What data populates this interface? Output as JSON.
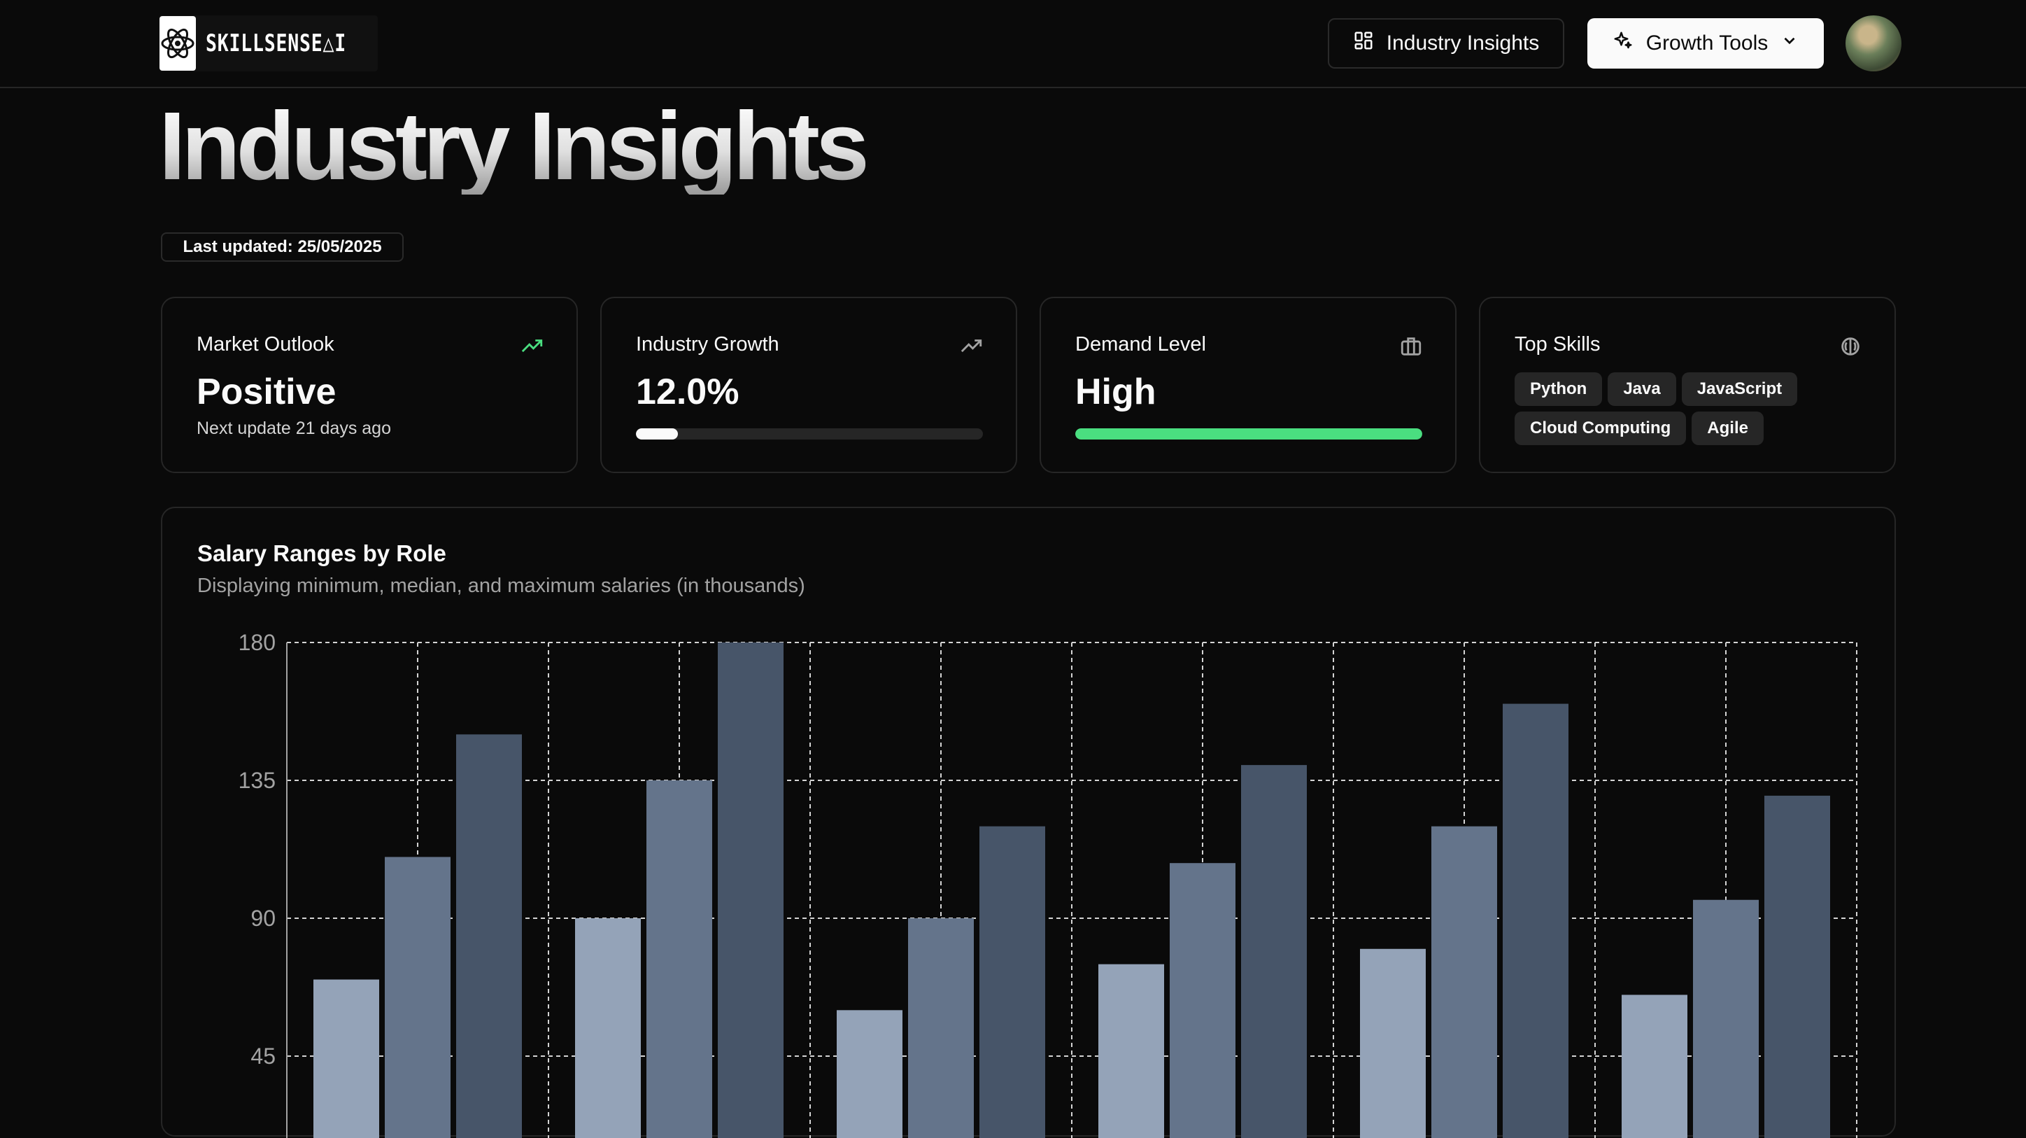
{
  "header": {
    "brand": "SKILLSENSE△I",
    "nav_insights_label": "Industry Insights",
    "nav_growth_label": "Growth Tools"
  },
  "page": {
    "title": "Industry Insights",
    "last_updated": "Last updated: 25/05/2025"
  },
  "cards": {
    "market_outlook": {
      "title": "Market Outlook",
      "value": "Positive",
      "sub": "Next update 21 days ago"
    },
    "industry_growth": {
      "title": "Industry Growth",
      "value": "12.0%",
      "progress": 0.12
    },
    "demand_level": {
      "title": "Demand Level",
      "value": "High",
      "progress": 1.0
    },
    "top_skills": {
      "title": "Top Skills",
      "skills": [
        "Python",
        "Java",
        "JavaScript",
        "Cloud Computing",
        "Agile"
      ]
    }
  },
  "colors": {
    "accent_green": "#4ade80",
    "min_bar": "#94a3b8",
    "median_bar": "#64748b",
    "max_bar": "#475569"
  },
  "chart": {
    "title": "Salary Ranges by Role",
    "subtitle": "Displaying minimum, median, and maximum salaries (in thousands)"
  },
  "chart_data": {
    "type": "bar",
    "ylim": [
      0,
      180
    ],
    "yticks": [
      45,
      90,
      135,
      180
    ],
    "grid": true,
    "series": [
      {
        "values": [
          70,
          90,
          60,
          75,
          80,
          65
        ]
      },
      {
        "values": [
          110,
          135,
          90,
          108,
          120,
          96
        ]
      },
      {
        "values": [
          150,
          180,
          120,
          140,
          160,
          130
        ]
      }
    ]
  }
}
